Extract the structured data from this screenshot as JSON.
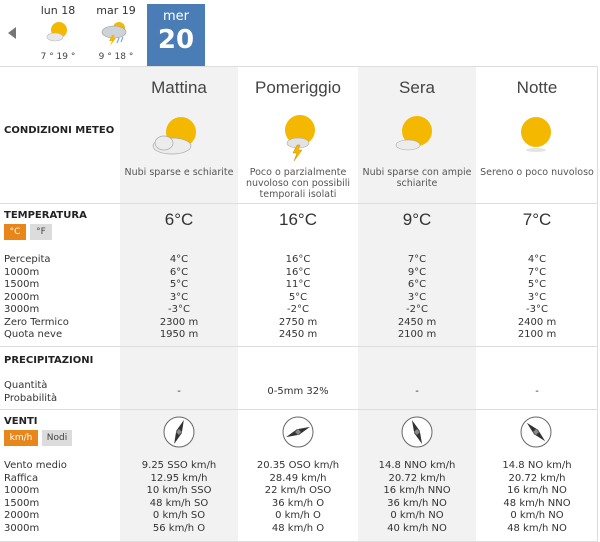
{
  "days": [
    {
      "label": "lun 18",
      "temps": "7 ° 19 °",
      "icon": "sun-cloud-icon"
    },
    {
      "label": "mar 19",
      "temps": "9 ° 18 °",
      "icon": "storm-cloud-icon"
    }
  ],
  "today": {
    "dayname": "mer",
    "num": "20"
  },
  "periods": [
    "Mattina",
    "Pomeriggio",
    "Sera",
    "Notte"
  ],
  "conditions": {
    "title": "CONDIZIONI METEO",
    "items": [
      "Nubi sparse e schiarite",
      "Poco o parzialmente nuvoloso con possibili temporali isolati",
      "Nubi sparse con ampie schiarite",
      "Sereno o poco nuvoloso"
    ]
  },
  "temperature": {
    "title": "TEMPERATURA",
    "unit_c": "°C",
    "unit_f": "°F",
    "main": [
      "6°C",
      "16°C",
      "9°C",
      "7°C"
    ],
    "row_labels": [
      "Percepita",
      "1000m",
      "1500m",
      "2000m",
      "3000m",
      "Zero Termico",
      "Quota neve"
    ],
    "values": [
      [
        "4°C",
        "6°C",
        "5°C",
        "3°C",
        "-3°C",
        "2300 m",
        "1950 m"
      ],
      [
        "16°C",
        "16°C",
        "11°C",
        "5°C",
        "-2°C",
        "2750 m",
        "2450 m"
      ],
      [
        "7°C",
        "9°C",
        "6°C",
        "3°C",
        "-2°C",
        "2450 m",
        "2100 m"
      ],
      [
        "4°C",
        "7°C",
        "5°C",
        "3°C",
        "-3°C",
        "2400 m",
        "2100 m"
      ]
    ]
  },
  "precipitation": {
    "title": "PRECIPITAZIONI",
    "row_labels": [
      "Quantità",
      "Probabilità"
    ],
    "values": [
      "-",
      "0-5mm 32%",
      "-",
      "-"
    ]
  },
  "wind": {
    "title": "VENTI",
    "unit_kmh": "km/h",
    "unit_knots": "Nodi",
    "row_labels": [
      "Vento medio",
      "Raffica",
      "1000m",
      "1500m",
      "2000m",
      "3000m"
    ],
    "values": [
      [
        "9.25 SSO km/h",
        "12.95 km/h",
        "10 km/h SSO",
        "48 km/h SO",
        "0 km/h SO",
        "56 km/h O"
      ],
      [
        "20.35 OSO km/h",
        "28.49 km/h",
        "22 km/h OSO",
        "36 km/h O",
        "0 km/h O",
        "48 km/h O"
      ],
      [
        "14.8 NNO km/h",
        "20.72 km/h",
        "16 km/h NNO",
        "36 km/h NO",
        "0 km/h NO",
        "40 km/h NO"
      ],
      [
        "14.8 NO km/h",
        "20.72 km/h",
        "16 km/h NO",
        "48 km/h NNO",
        "0 km/h NO",
        "48 km/h NO"
      ]
    ],
    "directions_deg": [
      202,
      247,
      337,
      315
    ]
  },
  "colors": {
    "today_bg": "#4a7db5",
    "unit_active": "#e8861a",
    "sun": "#f5b800"
  }
}
